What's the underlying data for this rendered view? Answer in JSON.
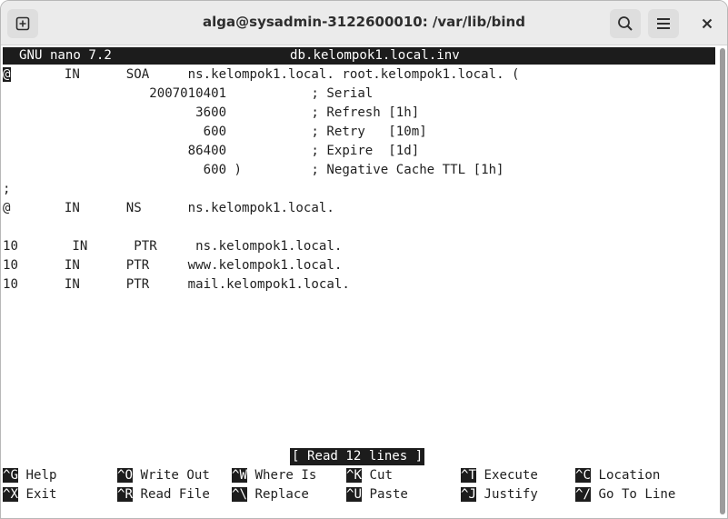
{
  "window": {
    "title": "alga@sysadmin-3122600010: /var/lib/bind",
    "buttons": {
      "new_tab_icon": "new-tab-icon",
      "search_icon": "search-icon",
      "menu_icon": "hamburger-menu-icon",
      "close_glyph": "✕"
    }
  },
  "nano": {
    "version": "GNU nano 7.2",
    "filename": "db.kelompok1.local.inv",
    "cursor_char": "@",
    "lines": [
      "       IN      SOA     ns.kelompok1.local. root.kelompok1.local. (",
      "                   2007010401           ; Serial",
      "                         3600           ; Refresh [1h]",
      "                          600           ; Retry   [10m]",
      "                        86400           ; Expire  [1d]",
      "                          600 )         ; Negative Cache TTL [1h]",
      ";",
      "@       IN      NS      ns.kelompok1.local.",
      "",
      "10       IN      PTR     ns.kelompok1.local.",
      "10      IN      PTR     www.kelompok1.local.",
      "10      IN      PTR     mail.kelompok1.local."
    ],
    "status": "[ Read 12 lines ]",
    "shortcuts_row1": [
      {
        "key": "^G",
        "label": "Help"
      },
      {
        "key": "^O",
        "label": "Write Out"
      },
      {
        "key": "^W",
        "label": "Where Is"
      },
      {
        "key": "^K",
        "label": "Cut"
      },
      {
        "key": "^T",
        "label": "Execute"
      },
      {
        "key": "^C",
        "label": "Location"
      }
    ],
    "shortcuts_row2": [
      {
        "key": "^X",
        "label": "Exit"
      },
      {
        "key": "^R",
        "label": "Read File"
      },
      {
        "key": "^\\",
        "label": "Replace"
      },
      {
        "key": "^U",
        "label": "Paste"
      },
      {
        "key": "^J",
        "label": "Justify"
      },
      {
        "key": "^/",
        "label": "Go To Line"
      }
    ]
  }
}
